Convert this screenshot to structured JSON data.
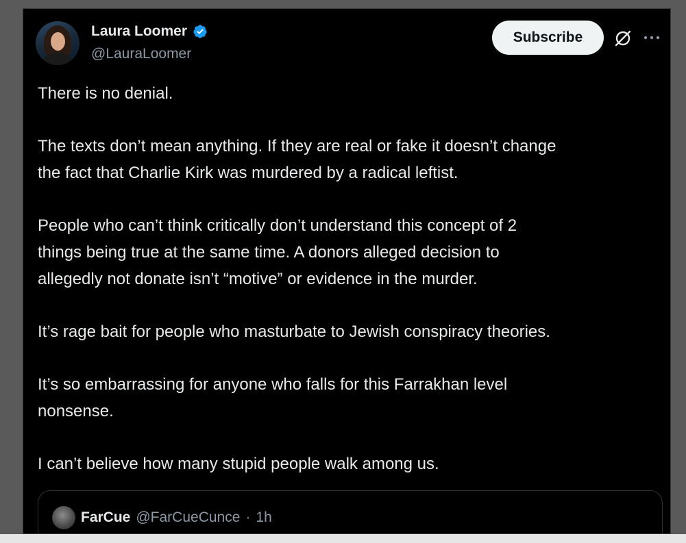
{
  "author": {
    "display_name": "Laura Loomer",
    "handle": "@LauraLoomer"
  },
  "actions": {
    "subscribe_label": "Subscribe",
    "grok_icon": "grok-icon",
    "more_icon": "more-icon"
  },
  "tweet": {
    "paragraphs": [
      "There is no denial.",
      "The texts don’t mean anything. If they are real or fake it doesn’t change\nthe fact that Charlie Kirk was murdered by a radical leftist.",
      "People who can’t think critically don’t understand this concept of 2\nthings being true at the same time. A donors alleged decision to\nallegedly not donate isn’t “motive” or evidence in the murder.",
      "It’s rage bait for people who masturbate to Jewish conspiracy theories.",
      "It’s so embarrassing for anyone who falls for this Farrakhan level\nnonsense.",
      "I can’t believe how many stupid people walk among us."
    ]
  },
  "quote": {
    "display_name": "FarCue",
    "handle": "@FarCueCunce",
    "separator": "·",
    "time": "1h"
  },
  "colors": {
    "background": "#000000",
    "text": "#e7e9ea",
    "secondary": "#8b98a5",
    "verified_blue": "#1d9bf0",
    "button_bg": "#eff3f4"
  }
}
